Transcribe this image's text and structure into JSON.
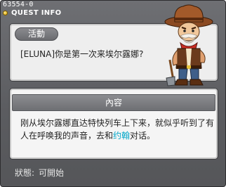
{
  "window": {
    "quest_id": "63554-0",
    "title": "QUEST INFO"
  },
  "dialog": {
    "tag_label": "活動",
    "greeting": "[ELUNA]你是第一次来埃尔露娜?"
  },
  "content": {
    "header": "內容",
    "text_part1": "刚从埃尔露娜直达特快列车上下来，就似乎听到了有人在呼唤我的声音，去和",
    "highlight_name": "约翰",
    "text_part2": "对话。"
  },
  "status": {
    "label": "狀態:",
    "value": "可開始"
  },
  "colors": {
    "highlight": "#00a6c8",
    "frame": "#5b5c60"
  },
  "icons": {
    "title_bullet": "gold-dot-icon",
    "npc": "cowboy-npc-portrait"
  }
}
